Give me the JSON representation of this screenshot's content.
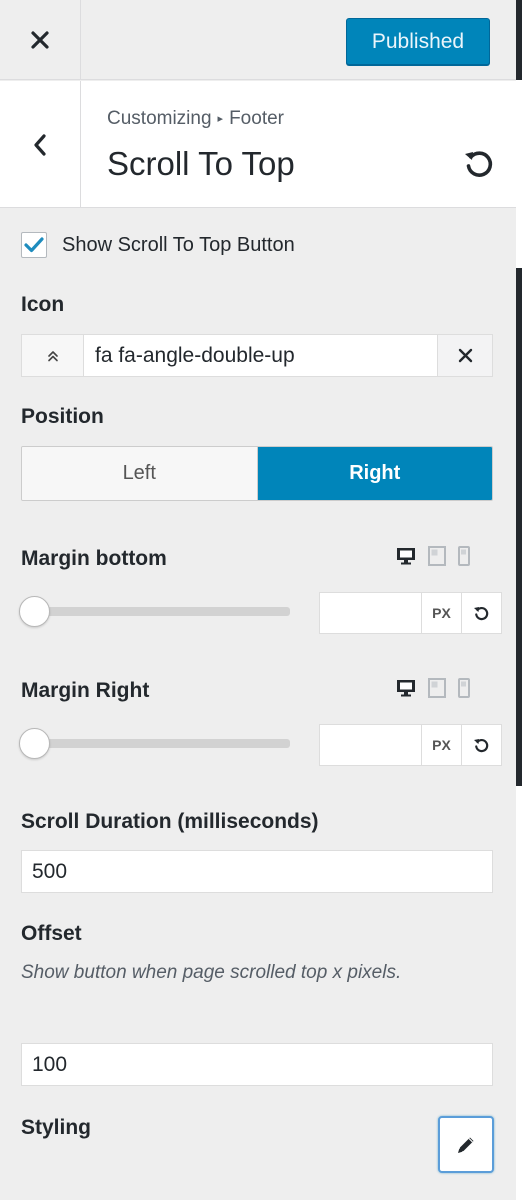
{
  "header": {
    "publish_label": "Published"
  },
  "section": {
    "breadcrumb_root": "Customizing",
    "breadcrumb_separator": "▸",
    "breadcrumb_parent": "Footer",
    "title": "Scroll To Top"
  },
  "controls": {
    "show_button": {
      "label": "Show Scroll To Top Button",
      "checked": true
    },
    "icon": {
      "label": "Icon",
      "value": "fa fa-angle-double-up",
      "preview_glyph": "≪"
    },
    "position": {
      "label": "Position",
      "options": [
        "Left",
        "Right"
      ],
      "selected": "Right"
    },
    "margin_bottom": {
      "label": "Margin bottom",
      "value": "",
      "unit": "PX",
      "slider_value": 0
    },
    "margin_right": {
      "label": "Margin Right",
      "value": "",
      "unit": "PX",
      "slider_value": 0
    },
    "scroll_duration": {
      "label": "Scroll Duration (milliseconds)",
      "value": "500"
    },
    "offset": {
      "label": "Offset",
      "description": "Show button when page scrolled top x pixels.",
      "value": "100"
    },
    "styling": {
      "label": "Styling"
    }
  },
  "colors": {
    "accent": "#0085ba",
    "panel_bg": "#eeeeee"
  }
}
